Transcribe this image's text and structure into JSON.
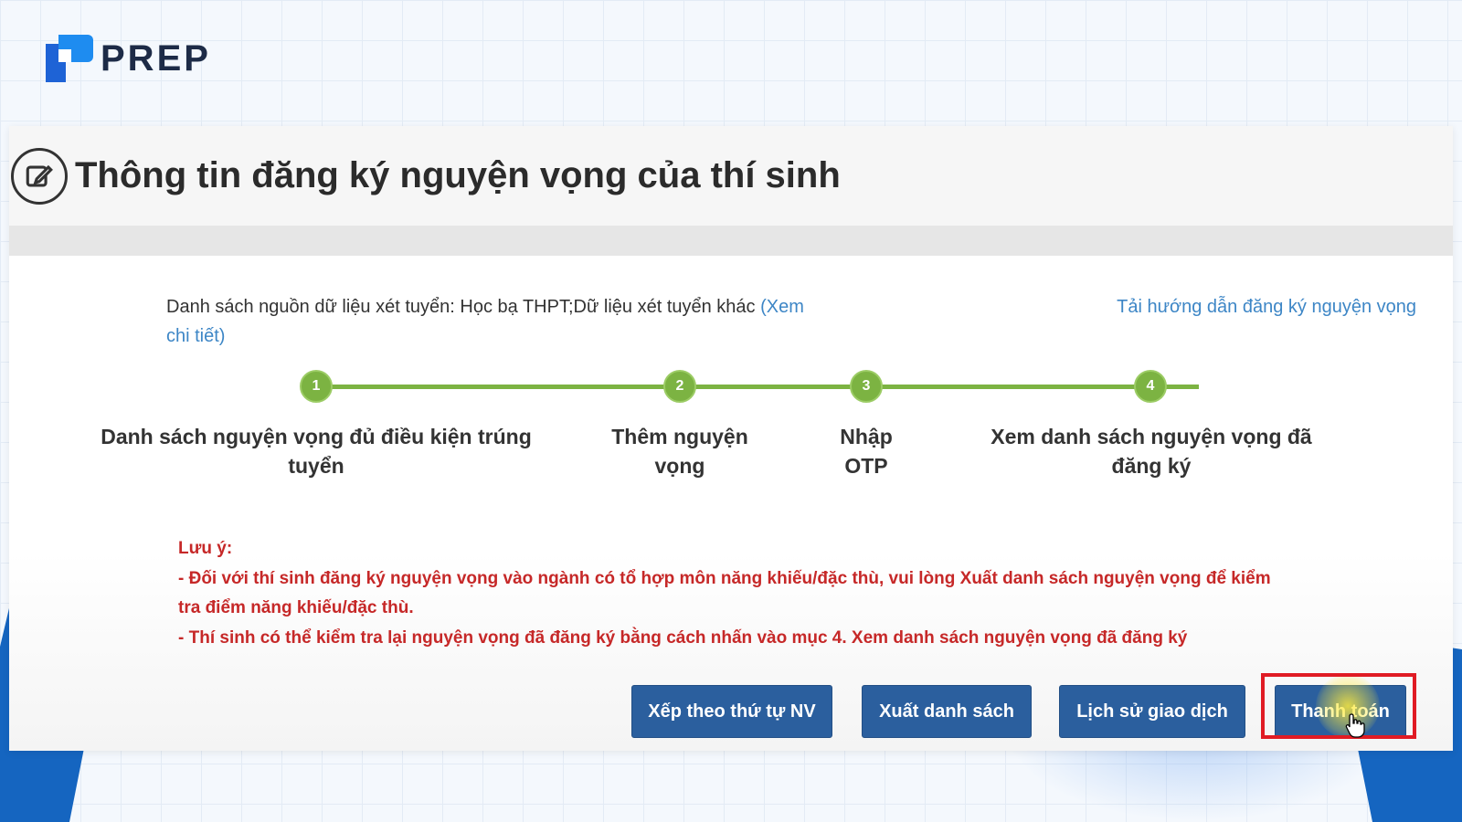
{
  "brand": {
    "name": "PREP"
  },
  "header": {
    "title": "Thông tin đăng ký nguyện vọng của thí sinh",
    "icon": "edit-icon"
  },
  "info": {
    "source_text": "Danh sách nguồn dữ liệu xét tuyển: Học bạ THPT;Dữ liệu xét tuyển khác ",
    "source_link": "(Xem chi tiết)",
    "guide_link": "Tải hướng dẫn đăng ký nguyện vọng"
  },
  "steps": [
    {
      "number": "1",
      "label": "Danh sách nguyện vọng đủ điều kiện trúng tuyển"
    },
    {
      "number": "2",
      "label": "Thêm nguyện vọng"
    },
    {
      "number": "3",
      "label": "Nhập OTP"
    },
    {
      "number": "4",
      "label": "Xem danh sách nguyện vọng đã đăng ký"
    }
  ],
  "notes": {
    "title": "Lưu ý:",
    "items": [
      "- Đối với thí sinh đăng ký nguyện vọng vào ngành có tổ hợp môn năng khiếu/đặc thù, vui lòng Xuất danh sách nguyện vọng để kiểm tra điểm năng khiếu/đặc thù.",
      "- Thí sinh có thể kiểm tra lại nguyện vọng đã đăng ký bằng cách nhấn vào mục 4. Xem danh sách nguyện vọng đã đăng ký"
    ]
  },
  "buttons": {
    "sort": "Xếp theo thứ tự NV",
    "export": "Xuất danh sách",
    "history": "Lịch sử giao dịch",
    "pay": "Thanh toán"
  },
  "colors": {
    "accent": "#2b5f9e",
    "step": "#7cb342",
    "warning": "#c62828",
    "link": "#3d86c6",
    "highlight": "#e01b24"
  }
}
